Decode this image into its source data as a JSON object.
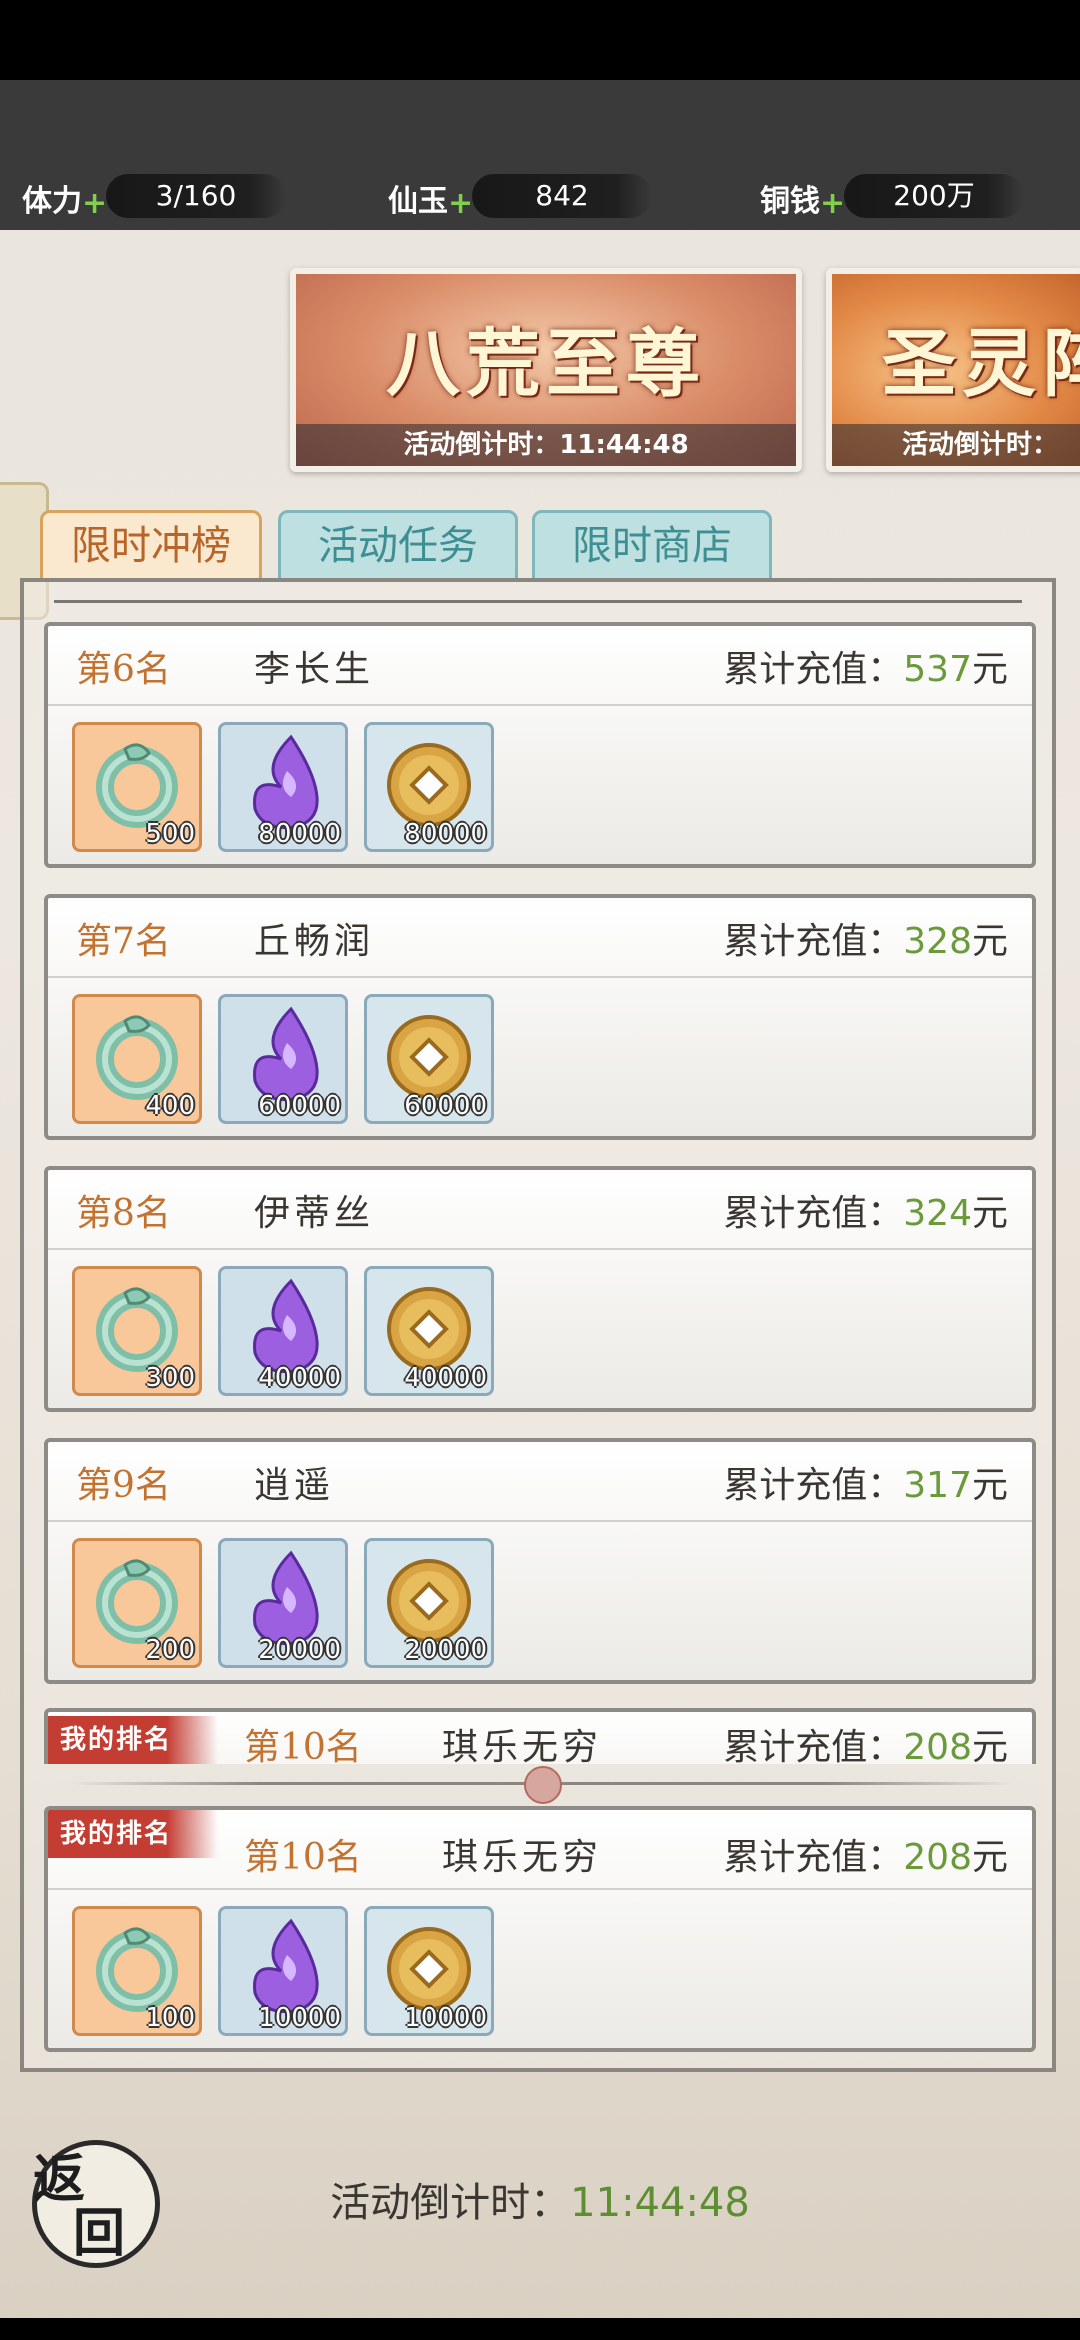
{
  "resources": [
    {
      "label": "体力",
      "value": "3/160"
    },
    {
      "label": "仙玉",
      "value": "842"
    },
    {
      "label": "铜钱",
      "value": "200万"
    }
  ],
  "plus_sign": "+",
  "banners": [
    {
      "title": "八荒至尊",
      "timer": "活动倒计时：11:44:48"
    },
    {
      "title": "圣灵阵",
      "timer": "活动倒计时："
    }
  ],
  "tabs": [
    "限时冲榜",
    "活动任务",
    "限时商店"
  ],
  "sum_label": "累计充值：",
  "currency": "元",
  "ranks": [
    {
      "rank": "第6名",
      "name": "李长生",
      "amount": "537",
      "items": [
        "500",
        "80000",
        "80000"
      ]
    },
    {
      "rank": "第7名",
      "name": "丘畅润",
      "amount": "328",
      "items": [
        "400",
        "60000",
        "60000"
      ]
    },
    {
      "rank": "第8名",
      "name": "伊蒂丝",
      "amount": "324",
      "items": [
        "300",
        "40000",
        "40000"
      ]
    },
    {
      "rank": "第9名",
      "name": "逍遥",
      "amount": "317",
      "items": [
        "200",
        "20000",
        "20000"
      ]
    }
  ],
  "my_rank": {
    "tag": "我的排名",
    "rank": "第10名",
    "name": "琪乐无穷",
    "amount": "208",
    "items": [
      "100",
      "10000",
      "10000"
    ]
  },
  "footer": {
    "back_label_1": "返",
    "back_label_2": "回",
    "timer_label": "活动倒计时：",
    "timer_value": "11:44:48"
  },
  "icons": {
    "item1": "jade-dragon-icon",
    "item2": "purple-crystal-icon",
    "item3": "copper-coin-icon"
  }
}
